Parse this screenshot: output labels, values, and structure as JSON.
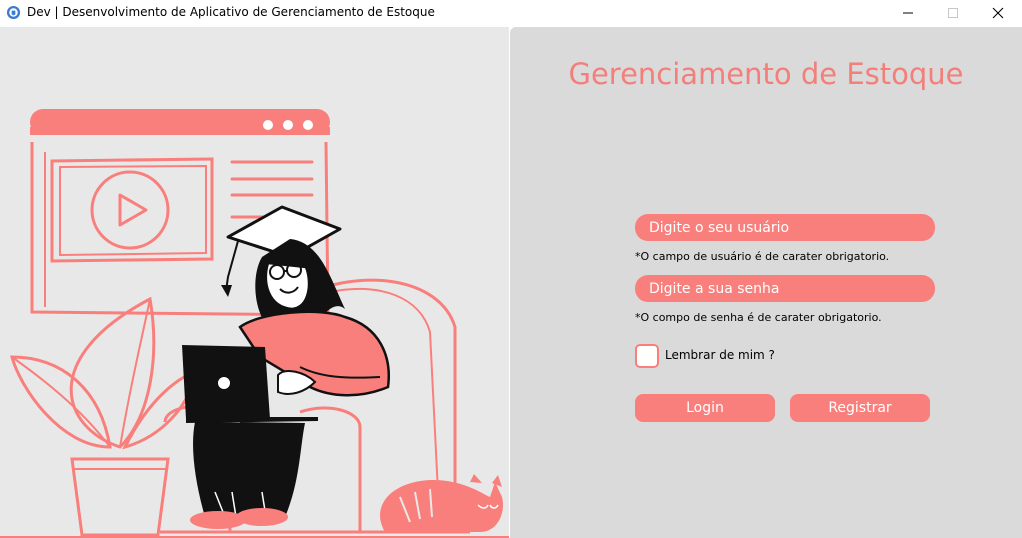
{
  "window": {
    "title": "Dev | Desenvolvimento de Aplicativo de Gerenciamento de Estoque",
    "minimize_label": "minimize",
    "maximize_label": "maximize",
    "close_label": "close"
  },
  "login": {
    "heading": "Gerenciamento de Estoque",
    "username_placeholder": "Digite o seu usuário",
    "username_value": "",
    "username_hint": "*O campo de usuário é de carater obrigatorio.",
    "password_placeholder": "Digite a sua senha",
    "password_value": "",
    "password_hint": "*O compo de senha é de carater obrigatorio.",
    "remember_label": "Lembrar de mim ?",
    "remember_checked": false,
    "login_label": "Login",
    "register_label": "Registrar"
  },
  "colors": {
    "accent": "#f97f7c",
    "heading": "#f37f7b",
    "left_bg": "#e9e8e8",
    "right_bg": "#dadada"
  },
  "icons": {
    "app": "app-icon",
    "illustration": "student-with-laptop-illustration"
  }
}
